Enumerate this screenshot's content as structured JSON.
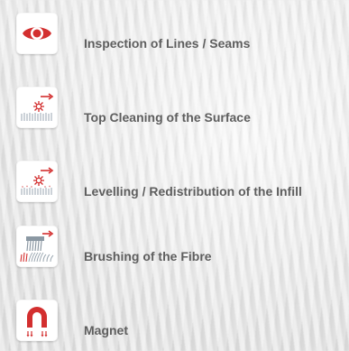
{
  "features": [
    {
      "icon": "eye-icon",
      "label": "Inspection of Lines / Seams"
    },
    {
      "icon": "surface-cleaning-icon",
      "label": "Top Cleaning of the Surface"
    },
    {
      "icon": "infill-levelling-icon",
      "label": "Levelling / Redistribution of the Infill"
    },
    {
      "icon": "fibre-brushing-icon",
      "label": "Brushing of the Fibre"
    },
    {
      "icon": "magnet-icon",
      "label": "Magnet"
    }
  ],
  "colors": {
    "accent": "#d32f2f",
    "text": "#5e5e5e",
    "muted": "#9aa6b0",
    "background": "#e9e9e9"
  }
}
